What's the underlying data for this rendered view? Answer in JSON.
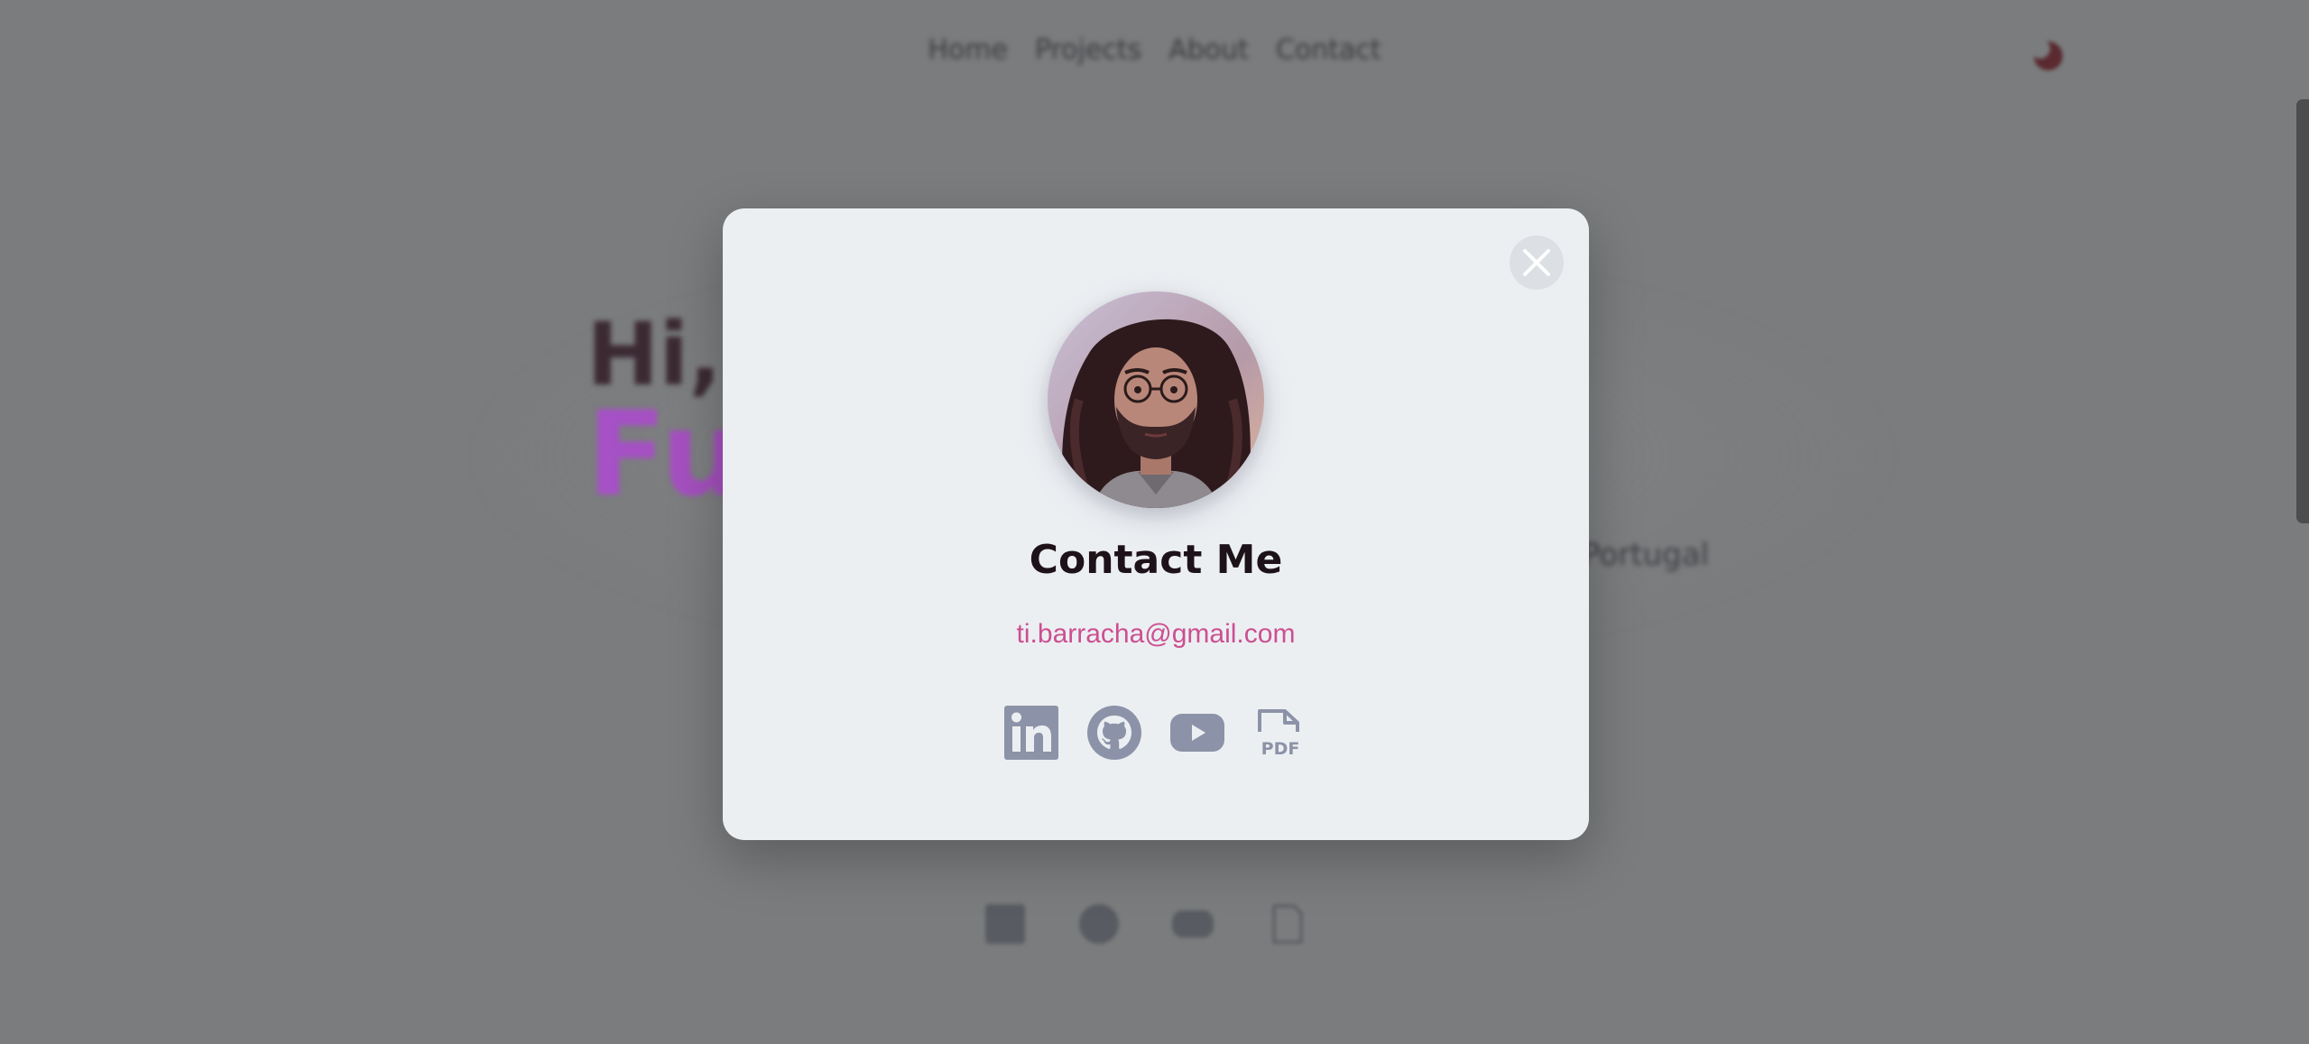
{
  "nav": {
    "items": [
      {
        "label": "Home"
      },
      {
        "label": "Projects"
      },
      {
        "label": "About"
      },
      {
        "label": "Contact"
      }
    ]
  },
  "hero": {
    "greeting": "Hi, I",
    "role": "Fu                        er",
    "location": "Portugal"
  },
  "modal": {
    "title": "Contact Me",
    "email": "ti.barracha@gmail.com",
    "close_icon": "close-icon",
    "socials": [
      {
        "name": "linkedin-icon"
      },
      {
        "name": "github-icon"
      },
      {
        "name": "youtube-icon"
      },
      {
        "name": "pdf-icon",
        "label": "PDF"
      }
    ]
  },
  "colors": {
    "overlay": "#7a7c7d",
    "modal_bg": "#eceff2",
    "email": "#cc4f91",
    "icon": "#8c93a8",
    "title": "#1d1218"
  }
}
